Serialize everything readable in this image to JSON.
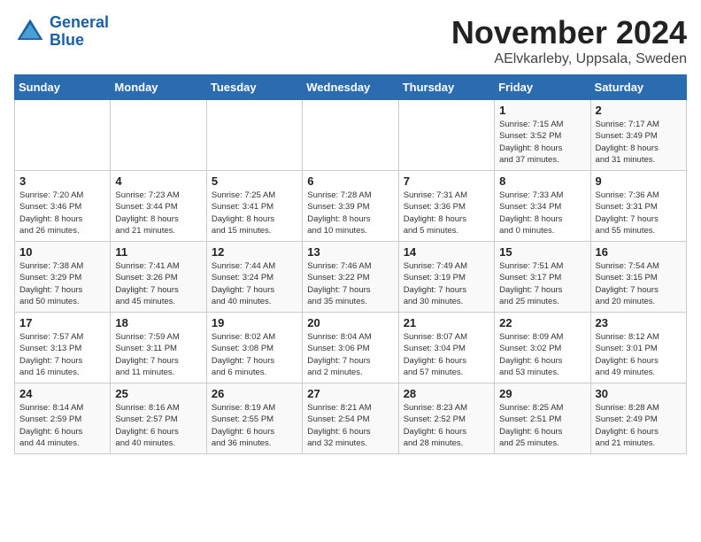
{
  "header": {
    "logo_general": "General",
    "logo_blue": "Blue",
    "month_title": "November 2024",
    "location": "AElvkarleby, Uppsala, Sweden"
  },
  "days_of_week": [
    "Sunday",
    "Monday",
    "Tuesday",
    "Wednesday",
    "Thursday",
    "Friday",
    "Saturday"
  ],
  "weeks": [
    [
      {
        "day": "",
        "detail": ""
      },
      {
        "day": "",
        "detail": ""
      },
      {
        "day": "",
        "detail": ""
      },
      {
        "day": "",
        "detail": ""
      },
      {
        "day": "",
        "detail": ""
      },
      {
        "day": "1",
        "detail": "Sunrise: 7:15 AM\nSunset: 3:52 PM\nDaylight: 8 hours\nand 37 minutes."
      },
      {
        "day": "2",
        "detail": "Sunrise: 7:17 AM\nSunset: 3:49 PM\nDaylight: 8 hours\nand 31 minutes."
      }
    ],
    [
      {
        "day": "3",
        "detail": "Sunrise: 7:20 AM\nSunset: 3:46 PM\nDaylight: 8 hours\nand 26 minutes."
      },
      {
        "day": "4",
        "detail": "Sunrise: 7:23 AM\nSunset: 3:44 PM\nDaylight: 8 hours\nand 21 minutes."
      },
      {
        "day": "5",
        "detail": "Sunrise: 7:25 AM\nSunset: 3:41 PM\nDaylight: 8 hours\nand 15 minutes."
      },
      {
        "day": "6",
        "detail": "Sunrise: 7:28 AM\nSunset: 3:39 PM\nDaylight: 8 hours\nand 10 minutes."
      },
      {
        "day": "7",
        "detail": "Sunrise: 7:31 AM\nSunset: 3:36 PM\nDaylight: 8 hours\nand 5 minutes."
      },
      {
        "day": "8",
        "detail": "Sunrise: 7:33 AM\nSunset: 3:34 PM\nDaylight: 8 hours\nand 0 minutes."
      },
      {
        "day": "9",
        "detail": "Sunrise: 7:36 AM\nSunset: 3:31 PM\nDaylight: 7 hours\nand 55 minutes."
      }
    ],
    [
      {
        "day": "10",
        "detail": "Sunrise: 7:38 AM\nSunset: 3:29 PM\nDaylight: 7 hours\nand 50 minutes."
      },
      {
        "day": "11",
        "detail": "Sunrise: 7:41 AM\nSunset: 3:26 PM\nDaylight: 7 hours\nand 45 minutes."
      },
      {
        "day": "12",
        "detail": "Sunrise: 7:44 AM\nSunset: 3:24 PM\nDaylight: 7 hours\nand 40 minutes."
      },
      {
        "day": "13",
        "detail": "Sunrise: 7:46 AM\nSunset: 3:22 PM\nDaylight: 7 hours\nand 35 minutes."
      },
      {
        "day": "14",
        "detail": "Sunrise: 7:49 AM\nSunset: 3:19 PM\nDaylight: 7 hours\nand 30 minutes."
      },
      {
        "day": "15",
        "detail": "Sunrise: 7:51 AM\nSunset: 3:17 PM\nDaylight: 7 hours\nand 25 minutes."
      },
      {
        "day": "16",
        "detail": "Sunrise: 7:54 AM\nSunset: 3:15 PM\nDaylight: 7 hours\nand 20 minutes."
      }
    ],
    [
      {
        "day": "17",
        "detail": "Sunrise: 7:57 AM\nSunset: 3:13 PM\nDaylight: 7 hours\nand 16 minutes."
      },
      {
        "day": "18",
        "detail": "Sunrise: 7:59 AM\nSunset: 3:11 PM\nDaylight: 7 hours\nand 11 minutes."
      },
      {
        "day": "19",
        "detail": "Sunrise: 8:02 AM\nSunset: 3:08 PM\nDaylight: 7 hours\nand 6 minutes."
      },
      {
        "day": "20",
        "detail": "Sunrise: 8:04 AM\nSunset: 3:06 PM\nDaylight: 7 hours\nand 2 minutes."
      },
      {
        "day": "21",
        "detail": "Sunrise: 8:07 AM\nSunset: 3:04 PM\nDaylight: 6 hours\nand 57 minutes."
      },
      {
        "day": "22",
        "detail": "Sunrise: 8:09 AM\nSunset: 3:02 PM\nDaylight: 6 hours\nand 53 minutes."
      },
      {
        "day": "23",
        "detail": "Sunrise: 8:12 AM\nSunset: 3:01 PM\nDaylight: 6 hours\nand 49 minutes."
      }
    ],
    [
      {
        "day": "24",
        "detail": "Sunrise: 8:14 AM\nSunset: 2:59 PM\nDaylight: 6 hours\nand 44 minutes."
      },
      {
        "day": "25",
        "detail": "Sunrise: 8:16 AM\nSunset: 2:57 PM\nDaylight: 6 hours\nand 40 minutes."
      },
      {
        "day": "26",
        "detail": "Sunrise: 8:19 AM\nSunset: 2:55 PM\nDaylight: 6 hours\nand 36 minutes."
      },
      {
        "day": "27",
        "detail": "Sunrise: 8:21 AM\nSunset: 2:54 PM\nDaylight: 6 hours\nand 32 minutes."
      },
      {
        "day": "28",
        "detail": "Sunrise: 8:23 AM\nSunset: 2:52 PM\nDaylight: 6 hours\nand 28 minutes."
      },
      {
        "day": "29",
        "detail": "Sunrise: 8:25 AM\nSunset: 2:51 PM\nDaylight: 6 hours\nand 25 minutes."
      },
      {
        "day": "30",
        "detail": "Sunrise: 8:28 AM\nSunset: 2:49 PM\nDaylight: 6 hours\nand 21 minutes."
      }
    ]
  ]
}
